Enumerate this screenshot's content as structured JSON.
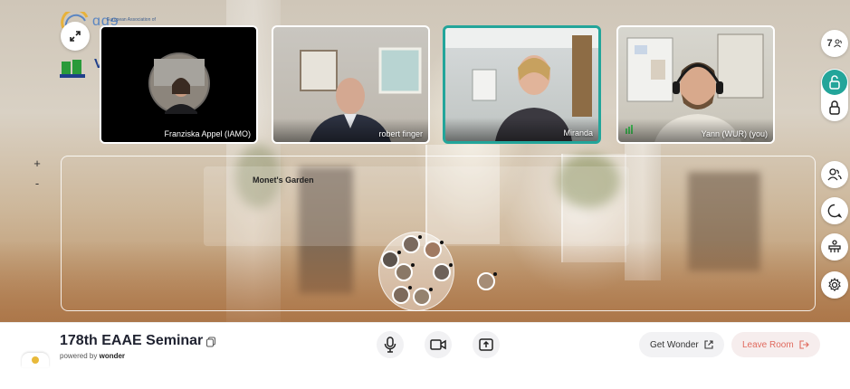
{
  "header": {
    "org_logo_text": "ɑɑɘ",
    "org_logo_subtext": "European Association of"
  },
  "participants": {
    "count": "7",
    "tiles": [
      {
        "name": "Franziska Appel (IAMO)"
      },
      {
        "name": "robert finger"
      },
      {
        "name": "Miranda"
      },
      {
        "name": "Yann (WUR) (you)"
      }
    ]
  },
  "zoom": {
    "plus": "+",
    "minus": "-"
  },
  "space": {
    "label": "Monet's Garden"
  },
  "room": {
    "title": "178th EAAE Seminar",
    "powered_prefix": "powered by",
    "powered_brand": "wonder"
  },
  "actions": {
    "get_wonder": "Get Wonder",
    "leave_room": "Leave Room"
  },
  "colors": {
    "accent": "#23a59a",
    "leave": "#e06a5e"
  }
}
